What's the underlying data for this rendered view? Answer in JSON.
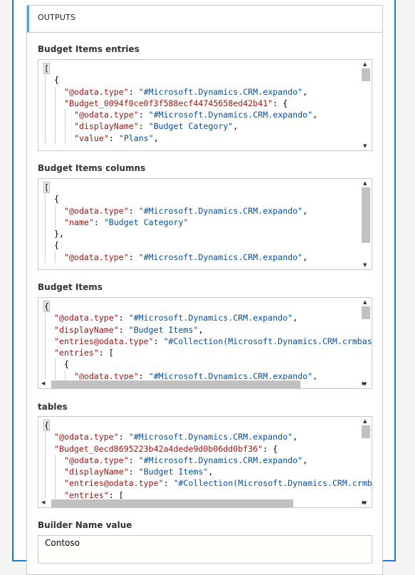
{
  "section_title": "OUTPUTS",
  "accent_color": "#5ba3dc",
  "fields": [
    {
      "label": "Budget Items entries",
      "lines": [
        {
          "indent": 0,
          "tokens": [
            {
              "t": "[",
              "c": "p"
            }
          ]
        },
        {
          "indent": 1,
          "tokens": [
            {
              "t": "{",
              "c": "p"
            }
          ]
        },
        {
          "indent": 2,
          "tokens": [
            {
              "t": "\"@odata.type\"",
              "c": "k"
            },
            {
              "t": ": ",
              "c": "p"
            },
            {
              "t": "\"#Microsoft.Dynamics.CRM.expando\"",
              "c": "s"
            },
            {
              "t": ",",
              "c": "p"
            }
          ]
        },
        {
          "indent": 2,
          "tokens": [
            {
              "t": "\"Budget_0094f0ce0f3f588ecf44745658ed42b41\"",
              "c": "k"
            },
            {
              "t": ": {",
              "c": "p"
            }
          ]
        },
        {
          "indent": 3,
          "tokens": [
            {
              "t": "\"@odata.type\"",
              "c": "k"
            },
            {
              "t": ": ",
              "c": "p"
            },
            {
              "t": "\"#Microsoft.Dynamics.CRM.expando\"",
              "c": "s"
            },
            {
              "t": ",",
              "c": "p"
            }
          ]
        },
        {
          "indent": 3,
          "tokens": [
            {
              "t": "\"displayName\"",
              "c": "k"
            },
            {
              "t": ": ",
              "c": "p"
            },
            {
              "t": "\"Budget Category\"",
              "c": "s"
            },
            {
              "t": ",",
              "c": "p"
            }
          ]
        },
        {
          "indent": 3,
          "tokens": [
            {
              "t": "\"value\"",
              "c": "k"
            },
            {
              "t": ": ",
              "c": "p"
            },
            {
              "t": "\"Plans\"",
              "c": "s"
            },
            {
              "t": ",",
              "c": "p"
            }
          ]
        }
      ]
    },
    {
      "label": "Budget Items columns",
      "lines": [
        {
          "indent": 0,
          "tokens": [
            {
              "t": "[",
              "c": "p"
            }
          ]
        },
        {
          "indent": 1,
          "tokens": [
            {
              "t": "{",
              "c": "p"
            }
          ]
        },
        {
          "indent": 2,
          "tokens": [
            {
              "t": "\"@odata.type\"",
              "c": "k"
            },
            {
              "t": ": ",
              "c": "p"
            },
            {
              "t": "\"#Microsoft.Dynamics.CRM.expando\"",
              "c": "s"
            },
            {
              "t": ",",
              "c": "p"
            }
          ]
        },
        {
          "indent": 2,
          "tokens": [
            {
              "t": "\"name\"",
              "c": "k"
            },
            {
              "t": ": ",
              "c": "p"
            },
            {
              "t": "\"Budget Category\"",
              "c": "s"
            }
          ]
        },
        {
          "indent": 1,
          "tokens": [
            {
              "t": "},",
              "c": "p"
            }
          ]
        },
        {
          "indent": 1,
          "tokens": [
            {
              "t": "{",
              "c": "p"
            }
          ]
        },
        {
          "indent": 2,
          "tokens": [
            {
              "t": "\"@odata.type\"",
              "c": "k"
            },
            {
              "t": ": ",
              "c": "p"
            },
            {
              "t": "\"#Microsoft.Dynamics.CRM.expando\"",
              "c": "s"
            },
            {
              "t": ",",
              "c": "p"
            }
          ]
        }
      ]
    },
    {
      "label": "Budget Items",
      "lines": [
        {
          "indent": 0,
          "tokens": [
            {
              "t": "{",
              "c": "p"
            }
          ]
        },
        {
          "indent": 1,
          "tokens": [
            {
              "t": "\"@odata.type\"",
              "c": "k"
            },
            {
              "t": ": ",
              "c": "p"
            },
            {
              "t": "\"#Microsoft.Dynamics.CRM.expando\"",
              "c": "s"
            },
            {
              "t": ",",
              "c": "p"
            }
          ]
        },
        {
          "indent": 1,
          "tokens": [
            {
              "t": "\"displayName\"",
              "c": "k"
            },
            {
              "t": ": ",
              "c": "p"
            },
            {
              "t": "\"Budget Items\"",
              "c": "s"
            },
            {
              "t": ",",
              "c": "p"
            }
          ]
        },
        {
          "indent": 1,
          "tokens": [
            {
              "t": "\"entries@odata.type\"",
              "c": "k"
            },
            {
              "t": ": ",
              "c": "p"
            },
            {
              "t": "\"#Collection(Microsoft.Dynamics.CRM.crmbase",
              "c": "s"
            }
          ]
        },
        {
          "indent": 1,
          "tokens": [
            {
              "t": "\"entries\"",
              "c": "k"
            },
            {
              "t": ": [",
              "c": "p"
            }
          ]
        },
        {
          "indent": 2,
          "tokens": [
            {
              "t": "{",
              "c": "p"
            }
          ]
        },
        {
          "indent": 3,
          "tokens": [
            {
              "t": "\"@odata.type\"",
              "c": "k"
            },
            {
              "t": ": ",
              "c": "p"
            },
            {
              "t": "\"#Microsoft.Dynamics.CRM.expando\"",
              "c": "s"
            },
            {
              "t": ",",
              "c": "p"
            }
          ]
        }
      ]
    },
    {
      "label": "tables",
      "lines": [
        {
          "indent": 0,
          "tokens": [
            {
              "t": "{",
              "c": "p"
            }
          ]
        },
        {
          "indent": 1,
          "tokens": [
            {
              "t": "\"@odata.type\"",
              "c": "k"
            },
            {
              "t": ": ",
              "c": "p"
            },
            {
              "t": "\"#Microsoft.Dynamics.CRM.expando\"",
              "c": "s"
            },
            {
              "t": ",",
              "c": "p"
            }
          ]
        },
        {
          "indent": 1,
          "tokens": [
            {
              "t": "\"Budget_0ecd8695223b42a4dede9d0b06dd0bf36\"",
              "c": "k"
            },
            {
              "t": ": {",
              "c": "p"
            }
          ]
        },
        {
          "indent": 2,
          "tokens": [
            {
              "t": "\"@odata.type\"",
              "c": "k"
            },
            {
              "t": ": ",
              "c": "p"
            },
            {
              "t": "\"#Microsoft.Dynamics.CRM.expando\"",
              "c": "s"
            },
            {
              "t": ",",
              "c": "p"
            }
          ]
        },
        {
          "indent": 2,
          "tokens": [
            {
              "t": "\"displayName\"",
              "c": "k"
            },
            {
              "t": ": ",
              "c": "p"
            },
            {
              "t": "\"Budget Items\"",
              "c": "s"
            },
            {
              "t": ",",
              "c": "p"
            }
          ]
        },
        {
          "indent": 2,
          "tokens": [
            {
              "t": "\"entries@odata.type\"",
              "c": "k"
            },
            {
              "t": ": ",
              "c": "p"
            },
            {
              "t": "\"#Collection(Microsoft.Dynamics.CRM.crmba",
              "c": "s"
            }
          ]
        },
        {
          "indent": 2,
          "tokens": [
            {
              "t": "\"entries\"",
              "c": "k"
            },
            {
              "t": ": [",
              "c": "p"
            }
          ]
        }
      ]
    }
  ],
  "builder_name": {
    "label": "Builder Name value",
    "value": "Contoso"
  }
}
